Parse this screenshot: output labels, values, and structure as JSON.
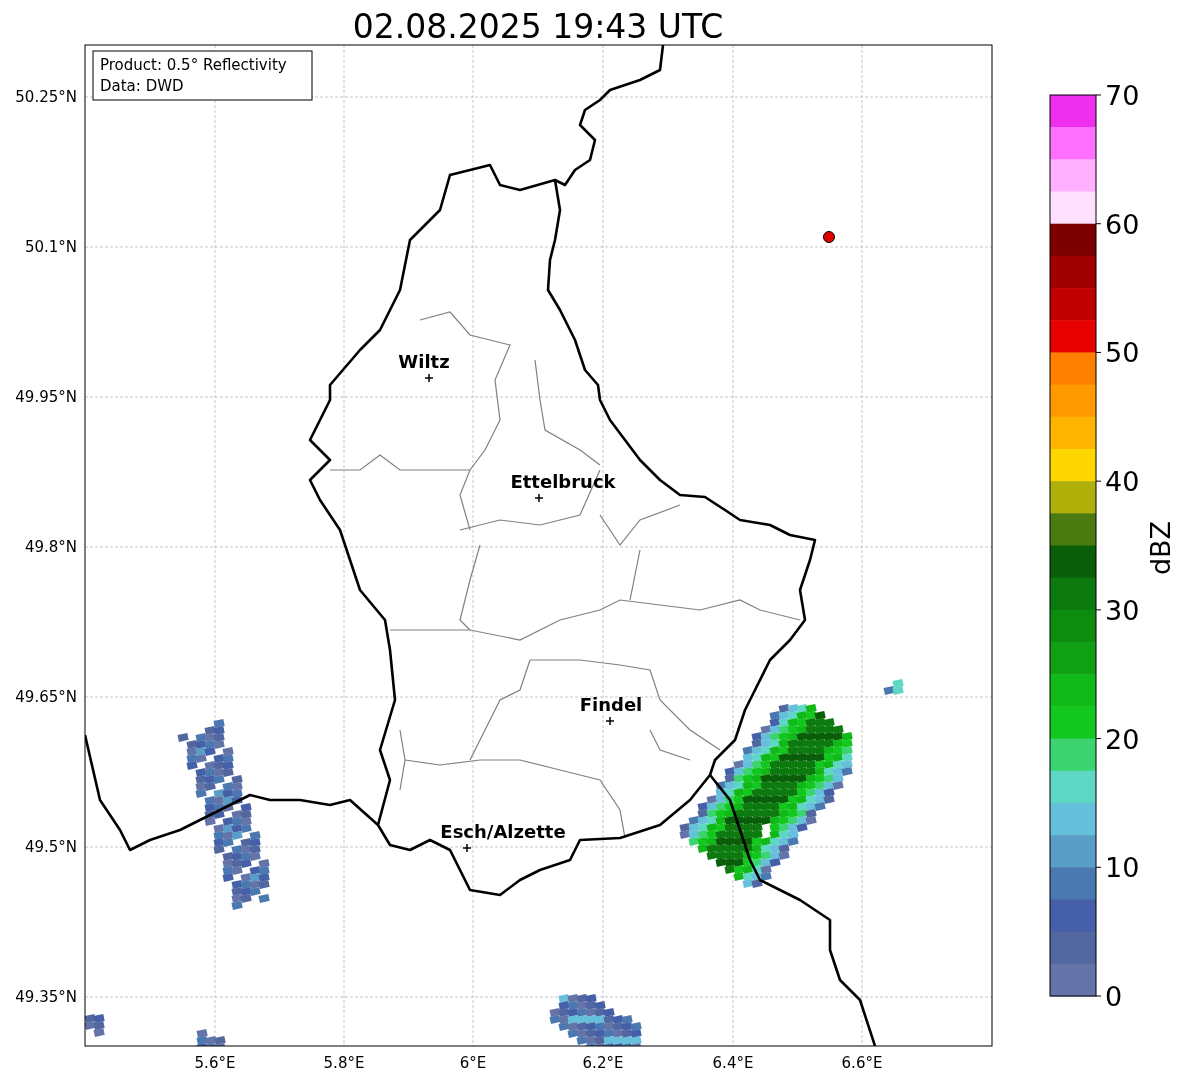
{
  "title": "02.08.2025 19:43 UTC",
  "info_box": {
    "lines": [
      "Product: 0.5° Reflectivity",
      "Data: DWD"
    ]
  },
  "map": {
    "y_ticks": [
      "50.25°N",
      "50.1°N",
      "49.95°N",
      "49.8°N",
      "49.65°N",
      "49.5°N",
      "49.35°N"
    ],
    "x_ticks": [
      "5.6°E",
      "5.8°E",
      "6°E",
      "6.2°E",
      "6.4°E",
      "6.6°E"
    ],
    "places": [
      {
        "name": "Wiltz"
      },
      {
        "name": "Ettelbruck"
      },
      {
        "name": "Findel"
      },
      {
        "name": "Esch/Alzette"
      }
    ]
  },
  "colorbar": {
    "label": "dBZ",
    "ticks": [
      "70",
      "60",
      "50",
      "40",
      "30",
      "20",
      "10",
      "0"
    ],
    "segments": [
      {
        "color": "#ee30ee"
      },
      {
        "color": "#ff70ff"
      },
      {
        "color": "#ffb0ff"
      },
      {
        "color": "#ffe0ff"
      },
      {
        "color": "#7c0000"
      },
      {
        "color": "#a00000"
      },
      {
        "color": "#c00000"
      },
      {
        "color": "#e60000"
      },
      {
        "color": "#ff7f00"
      },
      {
        "color": "#ff9b00"
      },
      {
        "color": "#ffb400"
      },
      {
        "color": "#ffd700"
      },
      {
        "color": "#b0b00a"
      },
      {
        "color": "#4a7a10"
      },
      {
        "color": "#0a5e0a"
      },
      {
        "color": "#0c7a0e"
      },
      {
        "color": "#0e8c10"
      },
      {
        "color": "#10a014"
      },
      {
        "color": "#10b818"
      },
      {
        "color": "#12c81e"
      },
      {
        "color": "#3cd470"
      },
      {
        "color": "#5ed8c4"
      },
      {
        "color": "#66c0dc"
      },
      {
        "color": "#5a9ec8"
      },
      {
        "color": "#4a78b0"
      },
      {
        "color": "#4560a8"
      },
      {
        "color": "#5266a0"
      },
      {
        "color": "#6474a8"
      }
    ]
  }
}
